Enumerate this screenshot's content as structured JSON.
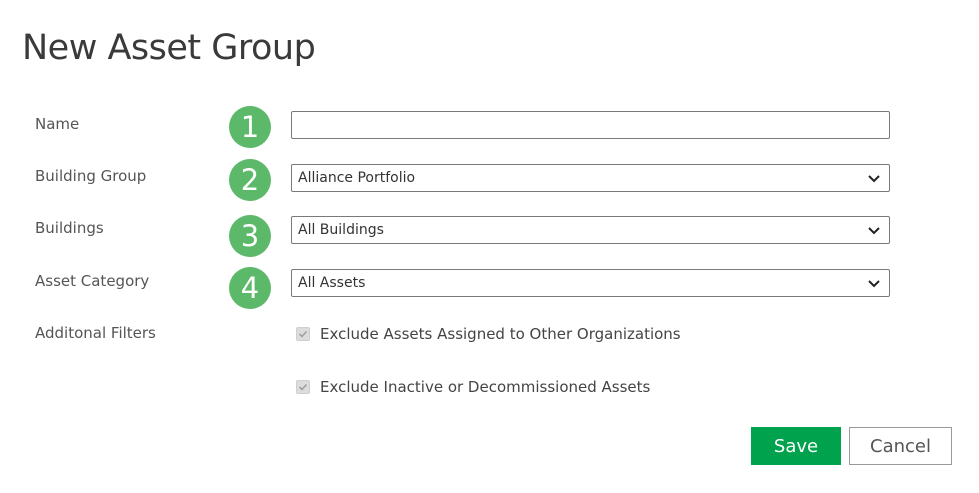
{
  "page": {
    "title": "New Asset Group"
  },
  "form": {
    "name": {
      "label": "Name",
      "step": "1",
      "value": ""
    },
    "building_group": {
      "label": "Building Group",
      "step": "2",
      "value": "Alliance Portfolio"
    },
    "buildings": {
      "label": "Buildings",
      "step": "3",
      "value": "All Buildings"
    },
    "asset_category": {
      "label": "Asset Category",
      "step": "4",
      "value": "All Assets"
    },
    "additional_filters": {
      "label": "Additonal Filters",
      "options": [
        {
          "label": "Exclude Assets Assigned to Other Organizations",
          "checked": true,
          "disabled": true
        },
        {
          "label": "Exclude Inactive or Decommissioned Assets",
          "checked": true,
          "disabled": true
        }
      ]
    }
  },
  "actions": {
    "save_label": "Save",
    "cancel_label": "Cancel"
  },
  "colors": {
    "badge": "#5cb96a",
    "save_button": "#00a24d"
  },
  "icons": {
    "select_arrow": "chevron-down-icon",
    "check": "checkmark-icon"
  }
}
